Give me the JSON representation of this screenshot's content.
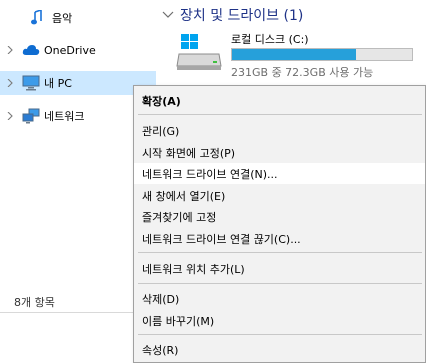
{
  "nav": {
    "music_label": "음악",
    "onedrive_label": "OneDrive",
    "thispc_label": "내 PC",
    "network_label": "네트워크"
  },
  "status": {
    "item_count": "8개 항목"
  },
  "content": {
    "group_title": "장치 및 드라이브 (1)",
    "drive": {
      "name": "로컬 디스크 (C:)",
      "free_text": "231GB 중 72.3GB 사용 가능",
      "used_fraction": 0.69
    }
  },
  "context_menu": {
    "expand": "확장(A)",
    "manage": "관리(G)",
    "pin_start": "시작 화면에 고정(P)",
    "map_network_drive": "네트워크 드라이브 연결(N)...",
    "open_new_window": "새 창에서 열기(E)",
    "pin_quick_access": "즐겨찾기에 고정",
    "disconnect_network_drive": "네트워크 드라이브 연결 끊기(C)...",
    "add_network_location": "네트워크 위치 추가(L)",
    "delete": "삭제(D)",
    "rename": "이름 바꾸기(M)",
    "properties": "속성(R)"
  },
  "colors": {
    "selection": "#cce8ff",
    "accent": "#26a0da",
    "group_title": "#1e3287",
    "menu_bg": "#f2f2f2"
  }
}
